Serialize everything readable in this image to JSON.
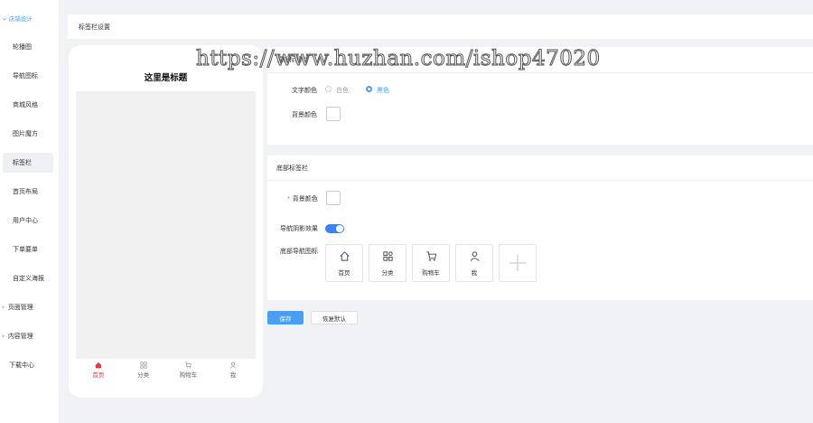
{
  "sidebar": {
    "group_label": "店铺设计",
    "items": [
      {
        "label": "轮播图"
      },
      {
        "label": "导航图标"
      },
      {
        "label": "商城风格"
      },
      {
        "label": "图片魔方"
      },
      {
        "label": "标签栏"
      },
      {
        "label": "首页布局"
      },
      {
        "label": "用户中心"
      },
      {
        "label": "下单要单"
      },
      {
        "label": "自定义海报"
      }
    ],
    "sub_groups": [
      {
        "label": "页面管理"
      },
      {
        "label": "内容管理"
      },
      {
        "label": "下载中心"
      }
    ]
  },
  "header": {
    "title": "标签栏设置"
  },
  "phone": {
    "title": "这里是标题",
    "tabs": [
      {
        "label": "首页",
        "icon": "home-icon"
      },
      {
        "label": "分类",
        "icon": "grid-icon"
      },
      {
        "label": "购物车",
        "icon": "cart-icon"
      },
      {
        "label": "我",
        "icon": "user-icon"
      }
    ]
  },
  "top_section": {
    "heading": "顶部标题栏",
    "text_color_label": "文字颜色",
    "option_white": "白色",
    "option_black": "黑色",
    "selected_option": "黑色",
    "bg_color_label": "背景颜色"
  },
  "bottom_section": {
    "heading": "底部标签栏",
    "bg_color_label": "背景颜色",
    "nav_effect_label": "导航阴影效果",
    "nav_effect_on": true,
    "icons_label": "底部导航图标",
    "icons": [
      {
        "label": "首页",
        "icon": "home-icon"
      },
      {
        "label": "分类",
        "icon": "grid-icon"
      },
      {
        "label": "购物车",
        "icon": "cart-icon"
      },
      {
        "label": "我",
        "icon": "user-icon"
      }
    ]
  },
  "buttons": {
    "save": "保存",
    "restore": "恢复默认"
  },
  "watermark": "https://www.huzhan.com/ishop47020",
  "colors": {
    "accent": "#4a9ff5",
    "active_tab": "#e23b3b"
  }
}
